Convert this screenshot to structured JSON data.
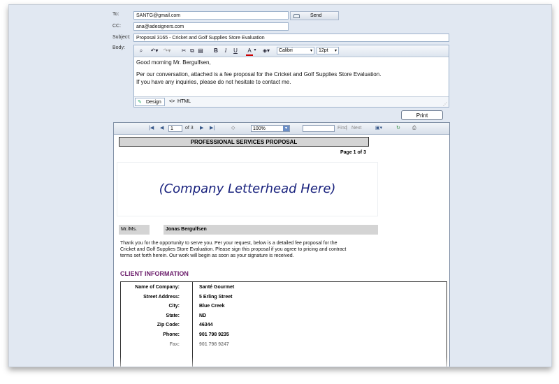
{
  "compose": {
    "to_label": "To:",
    "to_value": "SANTG@gmail.com",
    "send_label": "Send",
    "cc_label": "CC:",
    "cc_value": "ana@adesigners.com",
    "subject_label": "Subject:",
    "subject_value": "Proposal 3165 - Cricket and Golf Supplies Store Evaluation",
    "body_label": "Body:"
  },
  "editor_toolbar": {
    "font_name": "Calibri",
    "font_size": "12pt",
    "bold": "B",
    "italic": "I",
    "underline": "U",
    "font_color": "A"
  },
  "editor_body": {
    "line1": "Good morning Mr. Bergulfsen,",
    "line2": "Per our conversation, attached is a fee proposal for the Cricket and Golf Supplies Store Evaluation.",
    "line3": "If you have any inquiries, please do not hesitate to contact me."
  },
  "editor_modes": {
    "design": "Design",
    "html": "HTML"
  },
  "print_label": "Print",
  "viewer_toolbar": {
    "page_value": "1",
    "of_pages": "of 3",
    "zoom": "100%",
    "find": "Find",
    "next": "Next"
  },
  "report": {
    "title": "PROFESSIONAL SERVICES PROPOSAL",
    "page_of": "Page 1 of 3",
    "letterhead": "(Company Letterhead Here)",
    "salutation_label": "Mr./Ms.",
    "recipient_name": "Jonas Bergulfsen",
    "intro_line1": "Thank you for the opportunity to serve you. Per your request, below is a detailed fee proposal for the",
    "intro_line2": "Cricket and Golf Supplies Store Evaluation. Please sign this proposal if you agree to pricing and contract",
    "intro_line3": "terms set forth herein. Our work will begin as soon as your signature is received.",
    "section_title": "CLIENT INFORMATION",
    "client_rows": [
      {
        "label": "Name of Company:",
        "value": "Santé Gourmet"
      },
      {
        "label": "Street Address:",
        "value": "5 Erling Street"
      },
      {
        "label": "City:",
        "value": "Blue Creek"
      },
      {
        "label": "State:",
        "value": "ND"
      },
      {
        "label": "Zip Code:",
        "value": "46344"
      },
      {
        "label": "Phone:",
        "value": "901 798 9235"
      },
      {
        "label": "Fax:",
        "value": "901 798 9247"
      }
    ]
  }
}
